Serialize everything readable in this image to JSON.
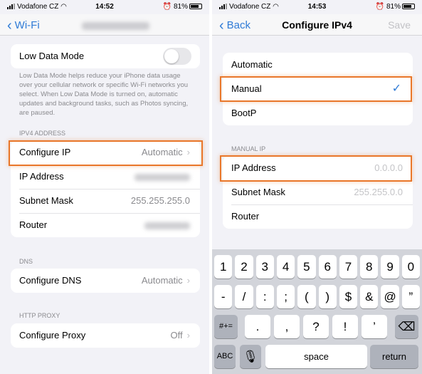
{
  "left": {
    "status": {
      "carrier": "Vodafone CZ",
      "time": "14:52",
      "battery": "81%"
    },
    "nav": {
      "back": "Wi-Fi"
    },
    "low_data": {
      "label": "Low Data Mode",
      "enabled": false,
      "footer": "Low Data Mode helps reduce your iPhone data usage over your cellular network or specific Wi-Fi networks you select. When Low Data Mode is turned on, automatic updates and background tasks, such as Photos syncing, are paused."
    },
    "ipv4": {
      "header": "IPV4 ADDRESS",
      "rows": [
        {
          "label": "Configure IP",
          "value": "Automatic"
        },
        {
          "label": "IP Address"
        },
        {
          "label": "Subnet Mask",
          "value": "255.255.255.0"
        },
        {
          "label": "Router"
        }
      ]
    },
    "dns": {
      "header": "DNS",
      "label": "Configure DNS",
      "value": "Automatic"
    },
    "proxy": {
      "header": "HTTP PROXY",
      "label": "Configure Proxy",
      "value": "Off"
    }
  },
  "right": {
    "status": {
      "carrier": "Vodafone CZ",
      "time": "14:53",
      "battery": "81%"
    },
    "nav": {
      "back": "Back",
      "title": "Configure IPv4",
      "save": "Save"
    },
    "modes": [
      "Automatic",
      "Manual",
      "BootP"
    ],
    "selected_mode": "Manual",
    "manual": {
      "header": "MANUAL IP",
      "rows": [
        {
          "label": "IP Address",
          "placeholder": "0.0.0.0"
        },
        {
          "label": "Subnet Mask",
          "placeholder": "255.255.0.0"
        },
        {
          "label": "Router"
        }
      ]
    },
    "keyboard": {
      "row1": [
        "1",
        "2",
        "3",
        "4",
        "5",
        "6",
        "7",
        "8",
        "9",
        "0"
      ],
      "row2": [
        "-",
        "/",
        ":",
        ";",
        "(",
        ")",
        "$",
        "&",
        "@",
        "”"
      ],
      "row3": [
        "#+=",
        ".",
        ",",
        "?",
        "!",
        "’"
      ],
      "row4": {
        "abc": "ABC",
        "space": "space",
        "return": "return"
      }
    }
  },
  "colors": {
    "accent": "#2f7bd6",
    "highlight": "#e9772a"
  }
}
